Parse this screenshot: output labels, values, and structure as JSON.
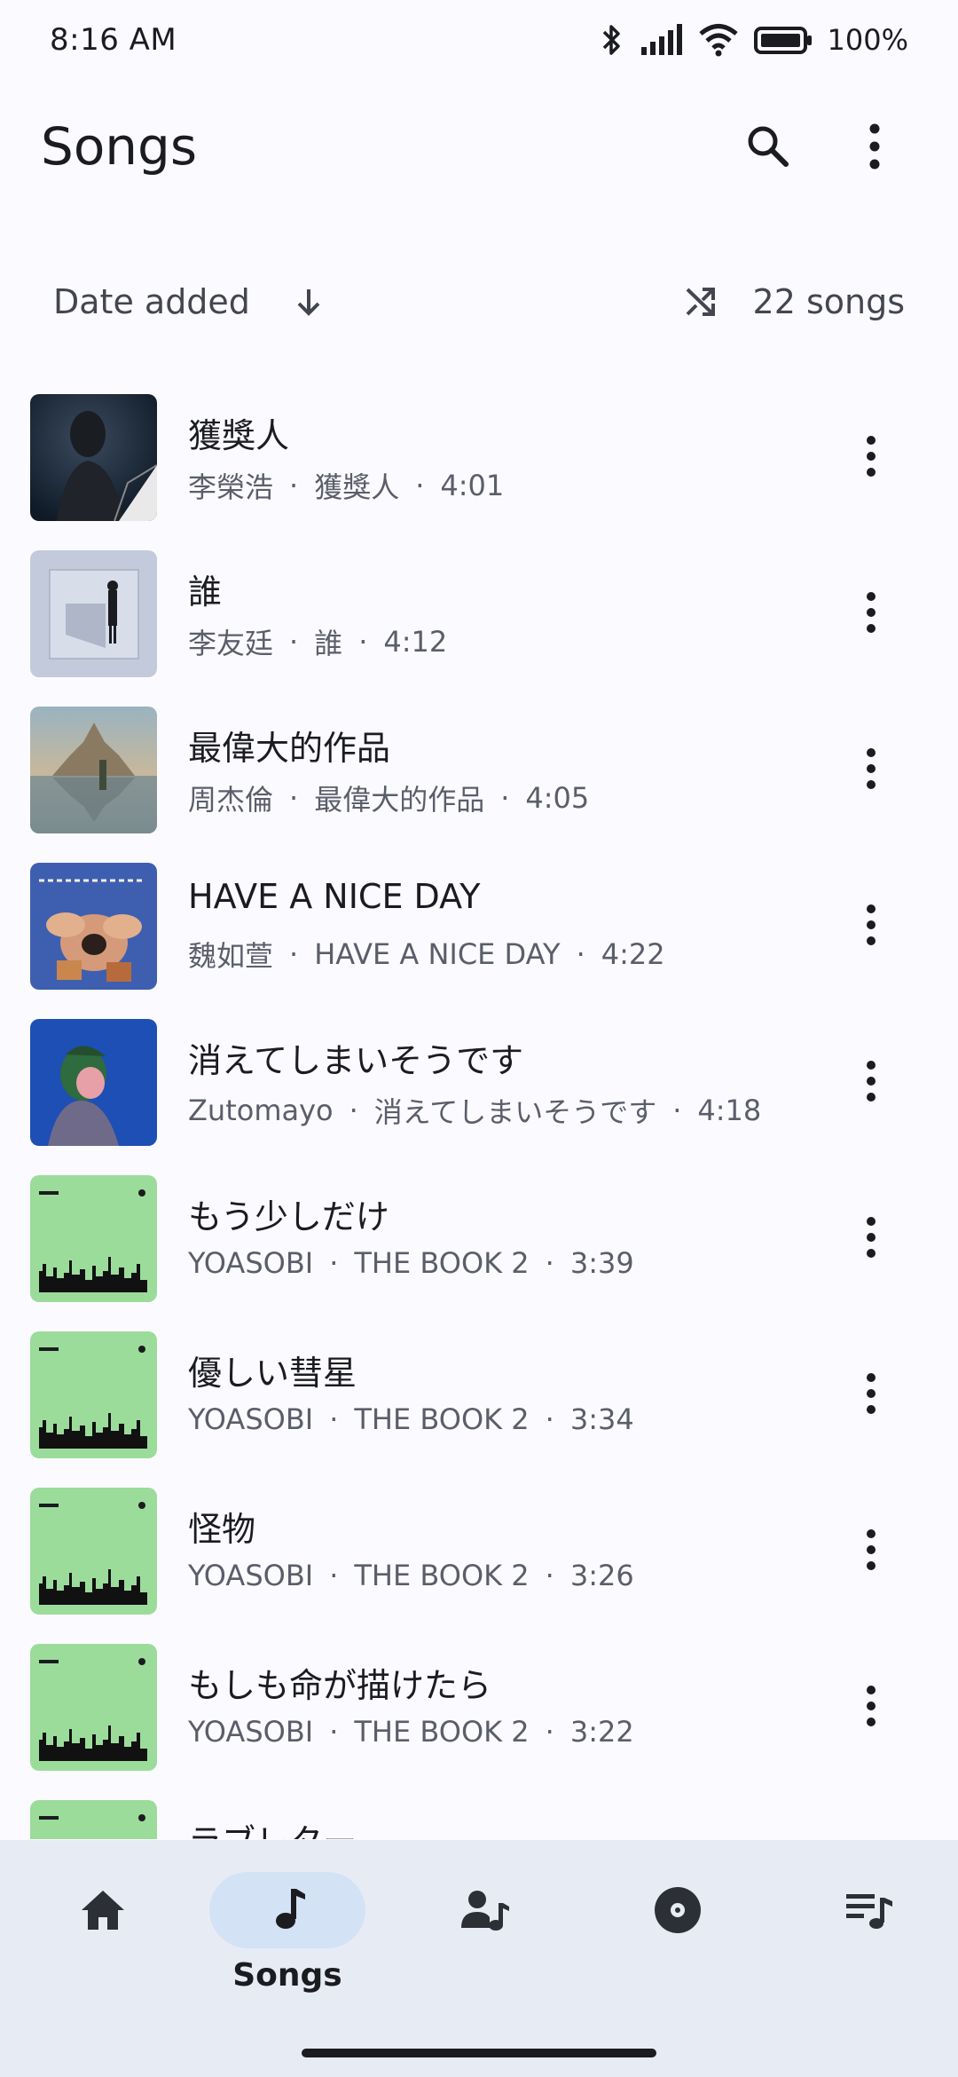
{
  "status": {
    "time": "8:16 AM",
    "battery": "100%"
  },
  "header": {
    "title": "Songs",
    "icons": [
      "search-icon",
      "more-vert-icon"
    ]
  },
  "sort": {
    "label": "Date added",
    "direction_icon": "arrow-down-icon",
    "shuffle_icon": "shuffle-icon",
    "count": "22 songs"
  },
  "songs": [
    {
      "title": "獲獎人",
      "artist": "李榮浩",
      "album": "獲獎人",
      "duration": "4:01",
      "art": "dark-portrait"
    },
    {
      "title": "誰",
      "artist": "李友廷",
      "album": "誰",
      "duration": "4:12",
      "art": "grey-figure"
    },
    {
      "title": "最偉大的作品",
      "artist": "周杰倫",
      "album": "最偉大的作品",
      "duration": "4:05",
      "art": "castle"
    },
    {
      "title": "HAVE A NICE DAY",
      "artist": "魏如萱",
      "album": "HAVE A NICE DAY",
      "duration": "4:22",
      "art": "hands"
    },
    {
      "title": "消えてしまいそうです",
      "artist": "Zutomayo",
      "album": "消えてしまいそうです",
      "duration": "4:18",
      "art": "blue-illustration"
    },
    {
      "title": "もう少しだけ",
      "artist": "YOASOBI",
      "album": "THE BOOK 2",
      "duration": "3:39",
      "art": "green-skyline"
    },
    {
      "title": "優しい彗星",
      "artist": "YOASOBI",
      "album": "THE BOOK 2",
      "duration": "3:34",
      "art": "green-skyline"
    },
    {
      "title": "怪物",
      "artist": "YOASOBI",
      "album": "THE BOOK 2",
      "duration": "3:26",
      "art": "green-skyline"
    },
    {
      "title": "もしも命が描けたら",
      "artist": "YOASOBI",
      "album": "THE BOOK 2",
      "duration": "3:22",
      "art": "green-skyline"
    },
    {
      "title": "ラブレター",
      "artist": "",
      "album": "",
      "duration": "",
      "art": "green-skyline"
    }
  ],
  "nav": {
    "items": [
      {
        "icon": "home-icon",
        "label": ""
      },
      {
        "icon": "music-note-icon",
        "label": "Songs"
      },
      {
        "icon": "artist-icon",
        "label": ""
      },
      {
        "icon": "album-disc-icon",
        "label": ""
      },
      {
        "icon": "playlist-icon",
        "label": ""
      }
    ],
    "active": "Songs"
  },
  "colors": {
    "background": "#fbfbff",
    "nav_background": "#e7ecf4",
    "nav_active_pill": "#d4e2f6",
    "text_primary": "#1b1c20",
    "text_secondary": "#5b5e6a"
  }
}
